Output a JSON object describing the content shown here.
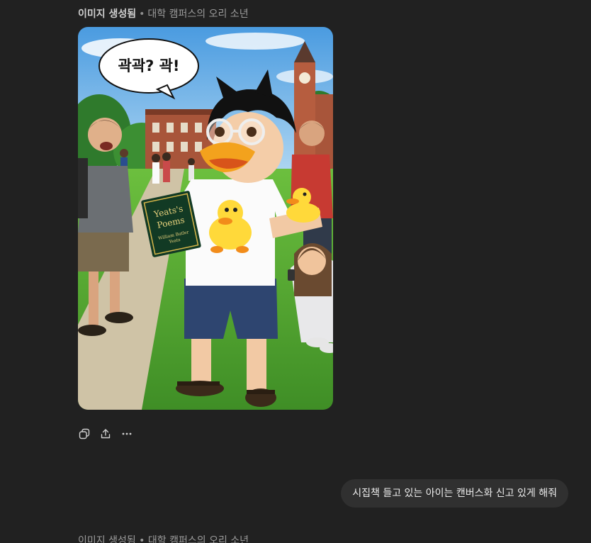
{
  "header": {
    "status": "이미지 생성됨",
    "separator": "•",
    "subtitle": "대학 캠퍼스의 오리 소년"
  },
  "image": {
    "speech_bubble": "곽곽? 곽!",
    "book_title_line1": "Yeats's",
    "book_title_line2": "Poems",
    "book_author_line1": "William Butler",
    "book_author_line2": "Yeats"
  },
  "actions": [
    {
      "name": "copy-button",
      "icon": "copy-icon"
    },
    {
      "name": "share-button",
      "icon": "share-icon"
    },
    {
      "name": "more-button",
      "icon": "more-icon"
    }
  ],
  "user_message": "시집책 들고 있는 아이는 캔버스화 신고 있게 해줘",
  "next_message_partial": "이미지 생성됨 • 대학 캠퍼스의 오리 소년"
}
